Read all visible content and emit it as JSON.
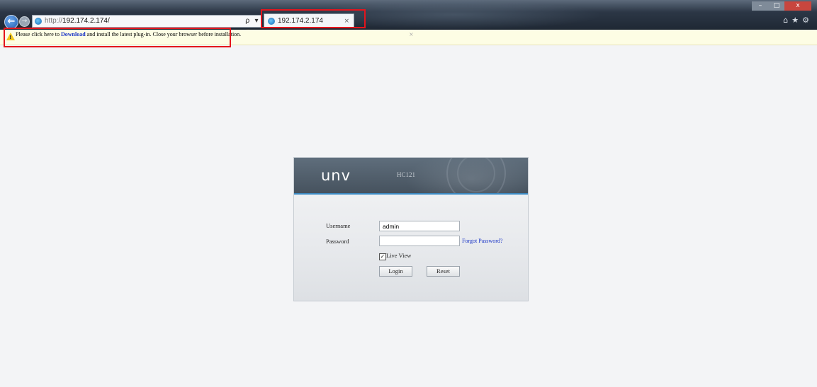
{
  "browser": {
    "address_protocol": "http://",
    "address_host": "192.174.2.174/",
    "address_tools": "ρ ▾ C",
    "tab_title": "192.174.2.174",
    "tab_close": "×",
    "back_glyph": "←",
    "forward_glyph": "→",
    "window_min": "–",
    "window_max": "□",
    "window_close": "x",
    "toolbar_icons": "⌂★⚙"
  },
  "infobar": {
    "text_before": "Please click here to ",
    "link_text": "Download",
    "text_after": " and install the latest plug-in. Close your browser before installation.",
    "close_glyph": "×",
    "warning_mark": "!"
  },
  "login": {
    "logo": "unv",
    "model": "HC121",
    "username_label": "Username",
    "username_value": "admin",
    "password_label": "Password",
    "password_value": "",
    "forgot_link": "Forgot Password?",
    "live_view_label": "Live View",
    "live_view_checked": true,
    "check_glyph": "✓",
    "login_button": "Login",
    "reset_button": "Reset"
  },
  "colors": {
    "highlight": "#e3151d",
    "link": "#1a35c6",
    "panel_accent": "#3c8bc4"
  }
}
